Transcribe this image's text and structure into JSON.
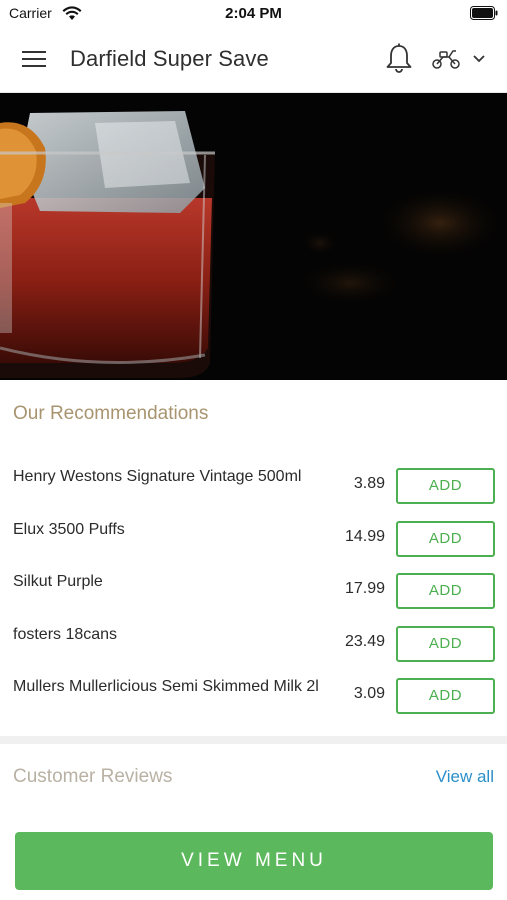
{
  "status_bar": {
    "carrier": "Carrier",
    "time": "2:04 PM",
    "icons": [
      "wifi-icon",
      "battery-icon"
    ]
  },
  "header": {
    "title": "Darfield Super Save",
    "icons": [
      "menu-icon",
      "bell-icon",
      "scooter-icon",
      "chevron-down-icon"
    ]
  },
  "recommendations": {
    "title": "Our Recommendations",
    "add_label": "ADD",
    "items": [
      {
        "name": "Henry Westons Signature Vintage 500ml",
        "price": "3.89"
      },
      {
        "name": "Elux 3500 Puffs",
        "price": "14.99"
      },
      {
        "name": "Silkut Purple",
        "price": "17.99"
      },
      {
        "name": "fosters 18cans",
        "price": "23.49"
      },
      {
        "name": "Mullers Mullerlicious Semi Skimmed Milk 2l",
        "price": "3.09"
      }
    ]
  },
  "reviews": {
    "title": "Customer Reviews",
    "view_all": "View all"
  },
  "footer": {
    "view_menu": "VIEW MENU"
  },
  "colors": {
    "accent_green": "#5cb85c",
    "section_title": "#a8946f",
    "link_blue": "#2b8fc9"
  }
}
